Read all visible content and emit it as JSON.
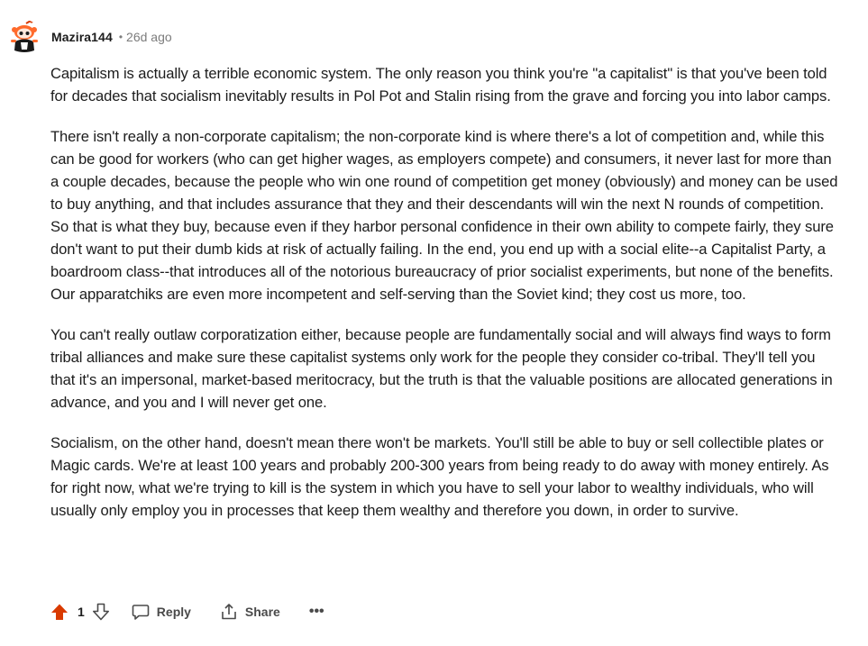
{
  "comment": {
    "author": "Mazira144",
    "separator": "•",
    "age": "26d ago",
    "paragraphs": [
      "Capitalism is actually a terrible economic system. The only reason you think you're \"a capitalist\" is that you've been told for decades that socialism inevitably results in Pol Pot and Stalin rising from the grave and forcing you into labor camps.",
      "There isn't really a non-corporate capitalism; the non-corporate kind is where there's a lot of competition and, while this can be good for workers (who can get higher wages, as employers compete) and consumers, it never last for more than a couple decades, because the people who win one round of competition get money (obviously) and money can be used to buy anything, and that includes assurance that they and their descendants will win the next N rounds of competition. So that is what they buy, because even if they harbor personal confidence in their own ability to compete fairly, they sure don't want to put their dumb kids at risk of actually failing. In the end, you end up with a social elite--a Capitalist Party, a boardroom class--that introduces all of the notorious bureaucracy of prior socialist experiments, but none of the benefits. Our apparatchiks are even more incompetent and self-serving than the Soviet kind; they cost us more, too.",
      "You can't really outlaw corporatization either, because people are fundamentally social and will always find ways to form tribal alliances and make sure these capitalist systems only work for the people they consider co-tribal. They'll tell you that it's an impersonal, market-based meritocracy, but the truth is that the valuable positions are allocated generations in advance, and you and I will never get one.",
      "Socialism, on the other hand, doesn't mean there won't be markets. You'll still be able to buy or sell collectible plates or Magic cards. We're at least 100 years and probably 200-300 years from being ready to do away with money entirely. As for right now, what we're trying to kill is the system in which you have to sell your labor to wealthy individuals, who will usually only employ you in processes that keep them wealthy and therefore you down, in order to survive."
    ]
  },
  "actions": {
    "score": "1",
    "reply_label": "Reply",
    "share_label": "Share",
    "more_label": "•••",
    "upvote_icon": "upvote-arrow-icon",
    "downvote_icon": "downvote-arrow-icon",
    "reply_icon": "comment-bubble-icon",
    "share_icon": "share-upload-icon",
    "upvote_color": "#d93a00"
  }
}
